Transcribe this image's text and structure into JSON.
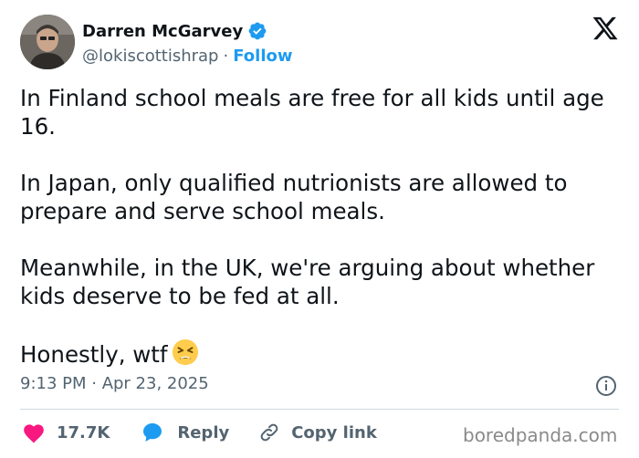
{
  "user": {
    "name": "Darren McGarvey",
    "handle": "@lokiscottishrap",
    "separator": "·",
    "follow_label": "Follow"
  },
  "tweet": {
    "paragraphs": [
      "In Finland school meals are free for all kids until age 16.",
      "In Japan, only qualified nutrionists are allowed to prepare and serve school meals.",
      "Meanwhile, in the UK, we're arguing about whether kids deserve to be fed at all.",
      "Honestly, wtf"
    ],
    "emoji": "tired-face-emoji"
  },
  "meta": {
    "timestamp": "9:13 PM · Apr 23, 2025"
  },
  "actions": {
    "likes": "17.7K",
    "reply_label": "Reply",
    "copy_link_label": "Copy link"
  },
  "watermark": "boredpanda.com",
  "colors": {
    "accent": "#1d9bf0",
    "like": "#f91880",
    "text": "#0f1419",
    "secondary": "#536471",
    "divider": "#cfd9de"
  },
  "icons": [
    "verified-badge-icon",
    "x-logo-icon",
    "info-icon",
    "heart-icon",
    "reply-bubble-icon",
    "link-icon"
  ]
}
